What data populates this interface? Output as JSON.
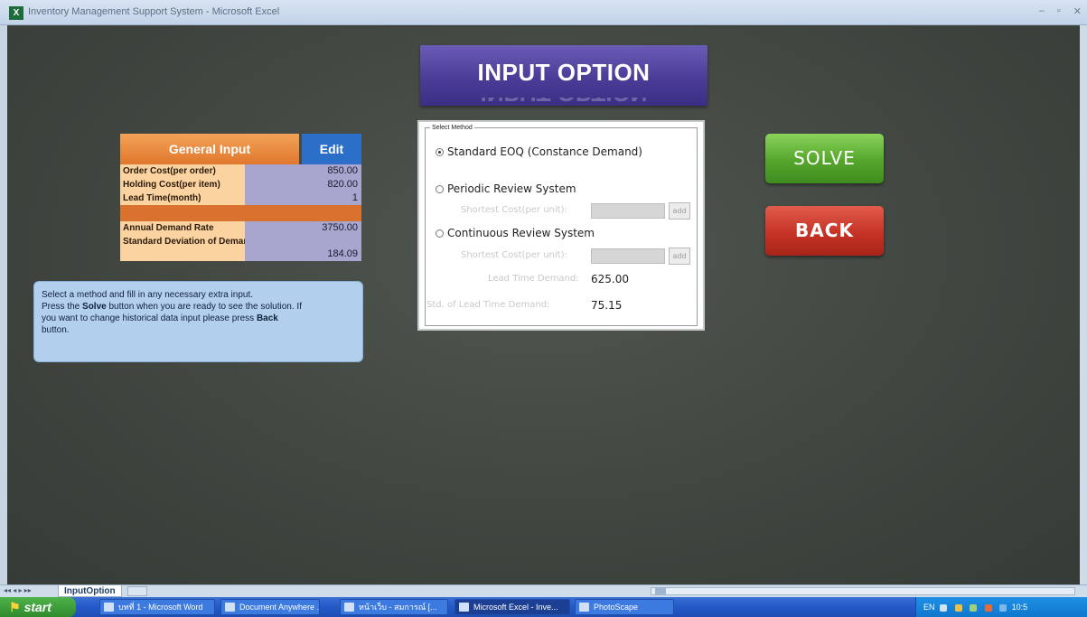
{
  "window": {
    "title": "Inventory Management Support System - Microsoft Excel"
  },
  "banner": {
    "title": "INPUT OPTION"
  },
  "general_input": {
    "header": "General Input",
    "edit_label": "Edit",
    "rows": [
      {
        "label": "Order Cost(per order)",
        "value": "850.00"
      },
      {
        "label": "Holding Cost(per item)",
        "value": "820.00"
      },
      {
        "label": "Lead Time(month)",
        "value": "1"
      }
    ],
    "annual_demand": {
      "label": "Annual Demand Rate",
      "value": "3750.00"
    },
    "std_dev": {
      "label": "Standard Deviation of Demand",
      "value": "184.09"
    }
  },
  "info": {
    "line1": "Select a method and fill in any necessary extra input.",
    "line2_pre": "Press the ",
    "line2_bold": "Solve",
    "line2_post": " button when you are ready to see the solution. If",
    "line3": "you want to change historical data input please press ",
    "line3_bold": "Back",
    "line4": "button."
  },
  "method": {
    "legend": "Select Method",
    "options": [
      {
        "label": "Standard EOQ (Constance Demand)",
        "selected": true
      },
      {
        "label": "Periodic Review System",
        "selected": false
      },
      {
        "label": "Continuous Review System",
        "selected": false
      }
    ],
    "periodic_sub_label": "Shortest Cost(per unit):",
    "continuous_sub_label": "Shortest Cost(per unit):",
    "add_label": "add",
    "lead_time_demand_label": "Lead Time Demand:",
    "lead_time_demand_value": "625.00",
    "std_lead_time_demand_label": "Std. of Lead Time Demand:",
    "std_lead_time_demand_value": "75.15"
  },
  "buttons": {
    "solve": "SOLVE",
    "back": "BACK"
  },
  "sheet_tabs": {
    "active": "InputOption"
  },
  "taskbar": {
    "start": "start",
    "items": [
      "บทที่ 1 - Microsoft Word",
      "Document Anywhere ...",
      "หน้าเว็บ - สมการณ์ [...",
      "Microsoft Excel - Inve...",
      "PhotoScape"
    ],
    "tray_lang": "EN",
    "clock": "10:5"
  },
  "colors": {
    "banner": "#4b3d97",
    "general_header": "#e0782e",
    "edit": "#2c6fc8",
    "solve": "#55a52c",
    "back": "#c53325",
    "info_box": "#b3cfee"
  }
}
